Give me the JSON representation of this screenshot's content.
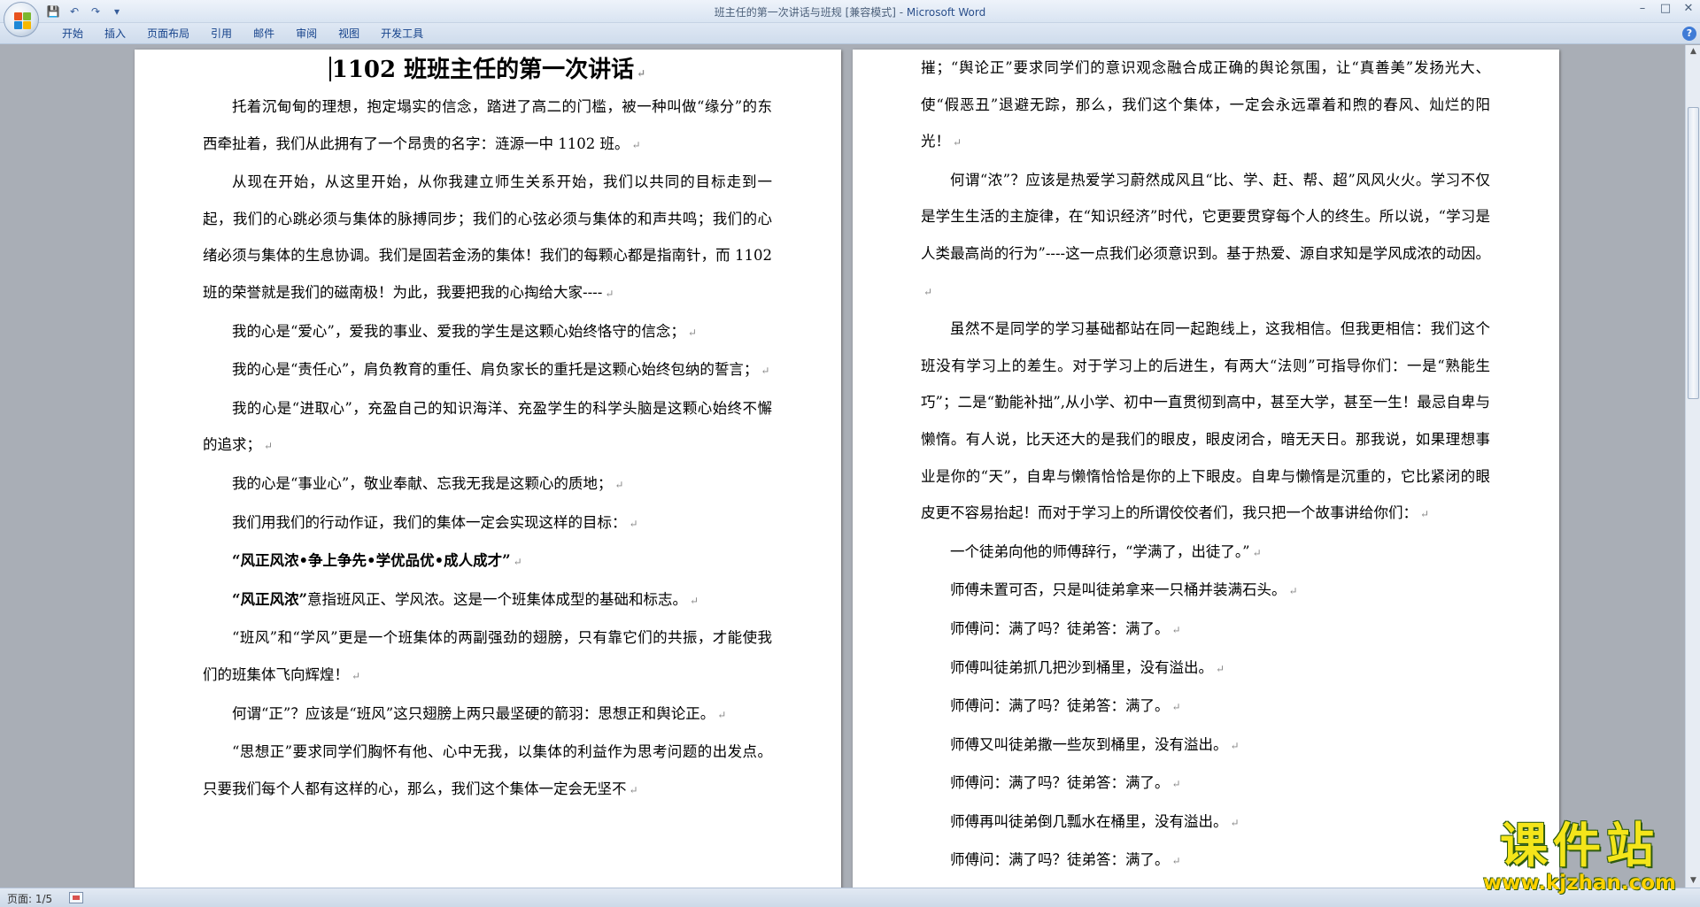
{
  "window": {
    "title": "班主任的第一次讲话与班规 [兼容模式] - ",
    "app": "Microsoft Word",
    "controls": {
      "minimize": "–",
      "maximize": "□",
      "close": "✕"
    }
  },
  "qat": {
    "save": "💾",
    "undo": "↶",
    "redo": "↷",
    "more": "▾"
  },
  "ribbon": {
    "tabs": [
      "开始",
      "插入",
      "页面布局",
      "引用",
      "邮件",
      "审阅",
      "视图",
      "开发工具"
    ],
    "help": "?"
  },
  "document": {
    "title": "1102 班班主任的第一次讲话",
    "left_paragraphs": [
      {
        "text": "托着沉甸甸的理想，抱定塌实的信念，踏进了高二的门槛，被一种叫做“缘分”的东西牵扯着，我们从此拥有了一个昂贵的名字：涟源一中 1102 班。"
      },
      {
        "text": "从现在开始，从这里开始，从你我建立师生关系开始，我们以共同的目标走到一起，我们的心跳必须与集体的脉搏同步；我们的心弦必须与集体的和声共鸣；我们的心绪必须与集体的生息协调。我们是固若金汤的集体！我们的每颗心都是指南针，而 1102 班的荣誉就是我们的磁南极！为此，我要把我的心掏给大家----"
      },
      {
        "text": "我的心是“爱心”，爱我的事业、爱我的学生是这颗心始终恪守的信念；"
      },
      {
        "text": "我的心是“责任心”，肩负教育的重任、肩负家长的重托是这颗心始终包纳的誓言；"
      },
      {
        "text": "我的心是“进取心”，充盈自己的知识海洋、充盈学生的科学头脑是这颗心始终不懈的追求；"
      },
      {
        "text": "我的心是“事业心”，敬业奉献、忘我无我是这颗心的质地；"
      },
      {
        "text": "我们用我们的行动作证，我们的集体一定会实现这样的目标："
      },
      {
        "bold": "“风正风浓•争上争先•学优品优•成人成才”",
        "text": ""
      },
      {
        "bold": "“风正风浓”",
        "text": "意指班风正、学风浓。这是一个班集体成型的基础和标志。"
      },
      {
        "text": "“班风”和“学风”更是一个班集体的两副强劲的翅膀，只有靠它们的共振，才能使我们的班集体飞向辉煌！"
      },
      {
        "text": "何谓“正”？应该是“班风”这只翅膀上两只最坚硬的箭羽：思想正和舆论正。"
      },
      {
        "text": "“思想正”要求同学们胸怀有他、心中无我，以集体的利益作为思考问题的出发点。只要我们每个人都有这样的心，那么，我们这个集体一定会无坚不"
      }
    ],
    "right_paragraphs": [
      {
        "text": "摧；“舆论正”要求同学们的意识观念融合成正确的舆论氛围，让“真善美”发扬光大、使“假恶丑”退避无踪，那么，我们这个集体，一定会永远罩着和煦的春风、灿烂的阳光！",
        "noindent": true
      },
      {
        "text": "何谓“浓”？应该是热爱学习蔚然成风且“比、学、赶、帮、超”风风火火。学习不仅是学生生活的主旋律，在“知识经济”时代，它更要贯穿每个人的终生。所以说，“学习是人类最高尚的行为”----这一点我们必须意识到。基于热爱、源自求知是学风成浓的动因。"
      },
      {
        "text": "虽然不是同学的学习基础都站在同一起跑线上，这我相信。但我更相信：我们这个班没有学习上的差生。对于学习上的后进生，有两大“法则”可指导你们：一是“熟能生巧”；二是“勤能补拙”,从小学、初中一直贯彻到高中，甚至大学，甚至一生！最忌自卑与懒惰。有人说，比天还大的是我们的眼皮，眼皮闭合，暗无天日。那我说，如果理想事业是你的“天”，自卑与懒惰恰恰是你的上下眼皮。自卑与懒惰是沉重的，它比紧闭的眼皮更不容易抬起！而对于学习上的所谓佼佼者们，我只把一个故事讲给你们："
      },
      {
        "text": "一个徒弟向他的师傅辞行，“学满了，出徒了。”"
      },
      {
        "text": "师傅未置可否，只是叫徒弟拿来一只桶并装满石头。"
      },
      {
        "text": "师傅问：满了吗？徒弟答：满了。"
      },
      {
        "text": "师傅叫徒弟抓几把沙到桶里，没有溢出。"
      },
      {
        "text": "师傅问：满了吗？徒弟答：满了。"
      },
      {
        "text": "师傅又叫徒弟撒一些灰到桶里，没有溢出。"
      },
      {
        "text": "师傅问：满了吗？徒弟答：满了。"
      },
      {
        "text": "师傅再叫徒弟倒几瓢水在桶里，没有溢出。"
      },
      {
        "text": "师傅问：满了吗？徒弟答：满了。"
      }
    ]
  },
  "paragraph_mark": "↵",
  "status": {
    "page": "页面: 1/5"
  },
  "watermark": {
    "cn": "课件站",
    "url": "www.kjzhan.com"
  }
}
